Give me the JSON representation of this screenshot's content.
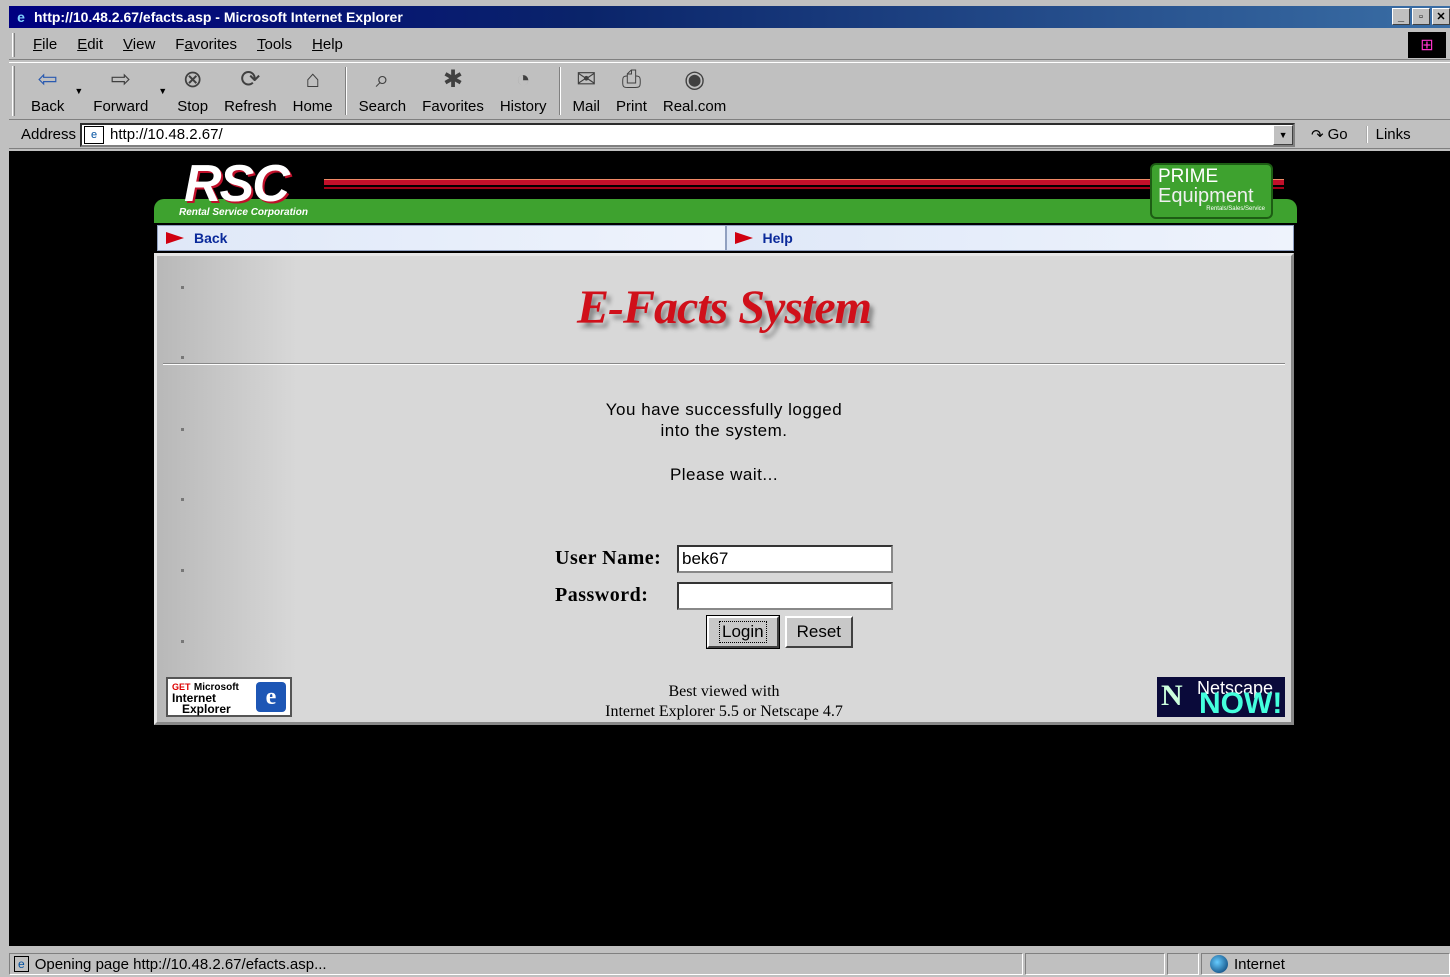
{
  "window": {
    "title": "http://10.48.2.67/efacts.asp - Microsoft Internet Explorer",
    "buttons": {
      "minimize": "_",
      "maximize": "▫",
      "close": "✕"
    }
  },
  "menubar": {
    "items": [
      {
        "label": "File",
        "key": "F",
        "rest": "ile"
      },
      {
        "label": "Edit",
        "key": "E",
        "rest": "dit"
      },
      {
        "label": "View",
        "key": "V",
        "rest": "iew"
      },
      {
        "label": "Favorites",
        "key": "a",
        "pre": "F",
        "rest": "vorites"
      },
      {
        "label": "Tools",
        "key": "T",
        "rest": "ools"
      },
      {
        "label": "Help",
        "key": "H",
        "rest": "elp"
      }
    ]
  },
  "toolbar": {
    "back": "Back",
    "forward": "Forward",
    "stop": "Stop",
    "refresh": "Refresh",
    "home": "Home",
    "search": "Search",
    "favorites": "Favorites",
    "history": "History",
    "mail": "Mail",
    "print": "Print",
    "realcom": "Real.com"
  },
  "addressbar": {
    "label": "Address",
    "url": "http://10.48.2.67/",
    "go": "Go",
    "links": "Links"
  },
  "page": {
    "logo": "RSC",
    "logo_sub": "Rental Service Corporation",
    "prime_line1": "PRIME",
    "prime_line2": "Equipment",
    "prime_line3": "Rentals/Sales/Service",
    "nav_back": "Back",
    "nav_help": "Help",
    "heading": "E-Facts System",
    "message_line1": "You have successfully logged",
    "message_line2": "into the system.",
    "wait": "Please wait...",
    "username_label": "User Name:",
    "username_value": "bek67",
    "password_label": "Password:",
    "password_value": "",
    "login_button": "Login",
    "reset_button": "Reset",
    "best_viewed_line1": "Best viewed with",
    "best_viewed_line2": "Internet Explorer 5.5 or Netscape 4.7",
    "ie_badge_get": "GET",
    "ie_badge_microsoft": "Microsoft",
    "ie_badge_internet": "Internet",
    "ie_badge_explorer": "Explorer",
    "ns_badge_line1": "Netscape",
    "ns_badge_line2": "NOW!"
  },
  "statusbar": {
    "text": "Opening page http://10.48.2.67/efacts.asp...",
    "zone": "Internet"
  },
  "colors": {
    "titlebar": "#000080",
    "brand_green": "#3ea22f",
    "brand_red": "#d0101a",
    "nav_link": "#0a2a9a"
  }
}
